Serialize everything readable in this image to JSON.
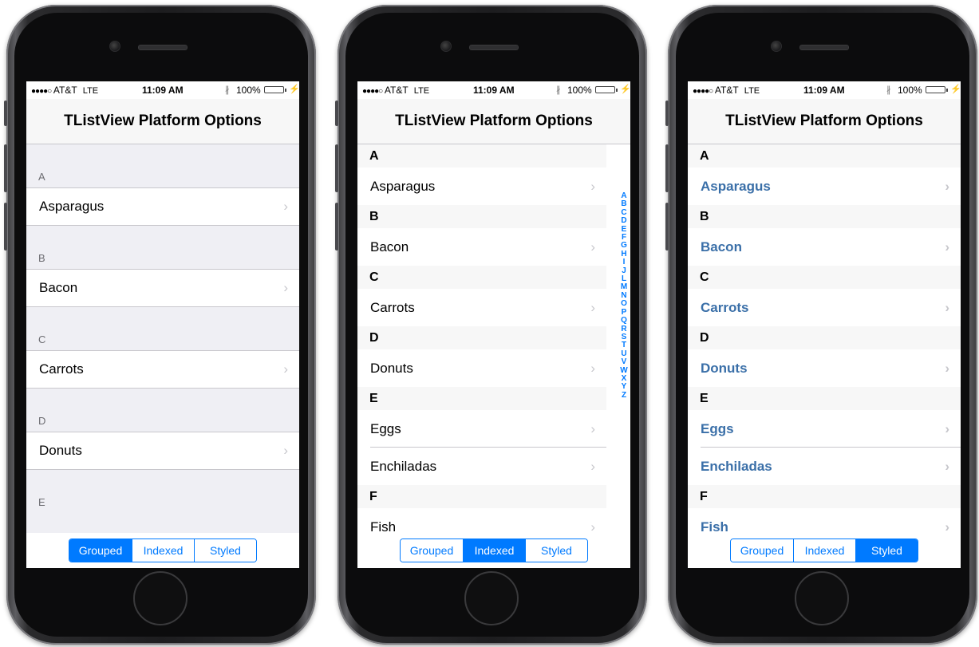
{
  "status_bar": {
    "signal": "●●●●○",
    "carrier": "AT&T",
    "network": "LTE",
    "time": "11:09 AM",
    "bluetooth": "∦",
    "battery_percent": "100%",
    "charging": "⚡"
  },
  "nav_title": "TListView Platform Options",
  "segmented_control": {
    "options": [
      "Grouped",
      "Indexed",
      "Styled"
    ]
  },
  "phones": [
    {
      "mode": "Grouped",
      "sections": [
        {
          "header": "A",
          "items": [
            "Asparagus"
          ]
        },
        {
          "header": "B",
          "items": [
            "Bacon"
          ]
        },
        {
          "header": "C",
          "items": [
            "Carrots"
          ]
        },
        {
          "header": "D",
          "items": [
            "Donuts"
          ]
        },
        {
          "header": "E",
          "items": []
        }
      ]
    },
    {
      "mode": "Indexed",
      "sections": [
        {
          "header": "A",
          "items": [
            "Asparagus"
          ]
        },
        {
          "header": "B",
          "items": [
            "Bacon"
          ]
        },
        {
          "header": "C",
          "items": [
            "Carrots"
          ]
        },
        {
          "header": "D",
          "items": [
            "Donuts"
          ]
        },
        {
          "header": "E",
          "items": [
            "Eggs",
            "Enchiladas"
          ]
        },
        {
          "header": "F",
          "items": [
            "Fish"
          ]
        }
      ],
      "index_letters": [
        "A",
        "B",
        "C",
        "D",
        "E",
        "F",
        "G",
        "H",
        "I",
        "J",
        "L",
        "M",
        "N",
        "O",
        "P",
        "Q",
        "R",
        "S",
        "T",
        "U",
        "V",
        "W",
        "X",
        "Y",
        "Z"
      ]
    },
    {
      "mode": "Styled",
      "sections": [
        {
          "header": "A",
          "items": [
            "Asparagus"
          ]
        },
        {
          "header": "B",
          "items": [
            "Bacon"
          ]
        },
        {
          "header": "C",
          "items": [
            "Carrots"
          ]
        },
        {
          "header": "D",
          "items": [
            "Donuts"
          ]
        },
        {
          "header": "E",
          "items": [
            "Eggs",
            "Enchiladas"
          ]
        },
        {
          "header": "F",
          "items": [
            "Fish"
          ]
        }
      ]
    }
  ],
  "icons": {
    "chevron": "›",
    "camera": "front-camera",
    "speaker": "earpiece-speaker",
    "home": "home-button"
  },
  "colors": {
    "accent": "#007aff",
    "styled_text": "#3a6fa8",
    "group_background": "#efeff4",
    "battery": "#4cd964"
  }
}
